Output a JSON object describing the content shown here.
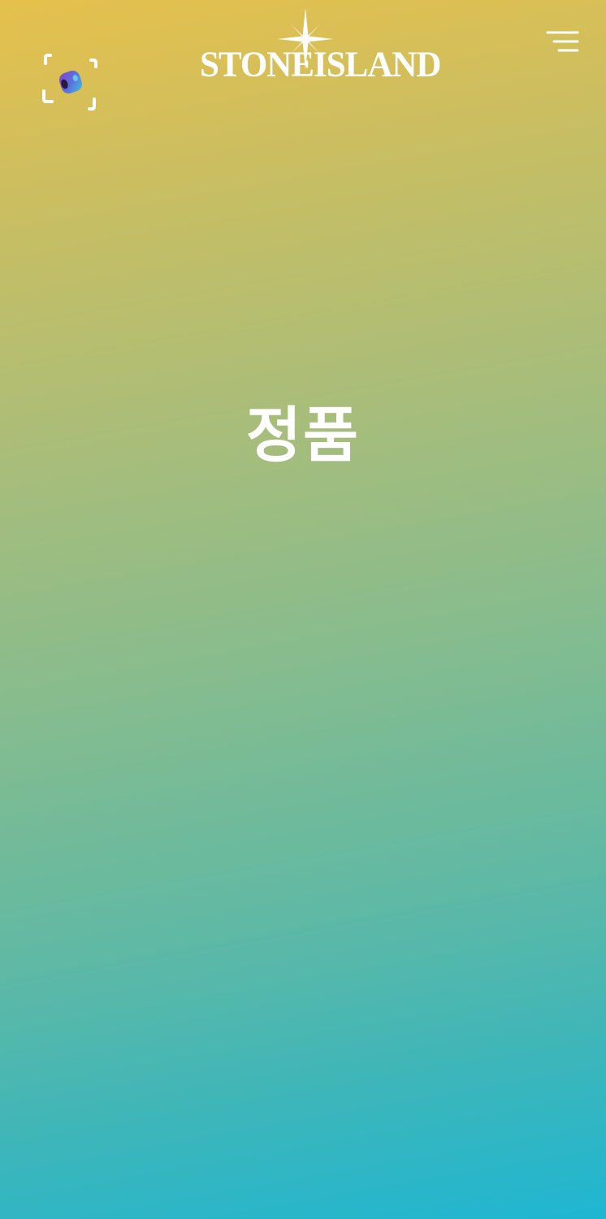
{
  "header": {
    "scan_icon": "camera-scan-icon",
    "logo": {
      "word1": "STONE",
      "word2": "ISLAND",
      "mark_icon": "compass-star-icon"
    },
    "menu_icon": "hamburger-menu-icon"
  },
  "main": {
    "headline": "정품"
  },
  "colors": {
    "gradient_top": "#e6c04c",
    "gradient_bottom": "#1fb6d2",
    "foreground": "#ffffff"
  }
}
